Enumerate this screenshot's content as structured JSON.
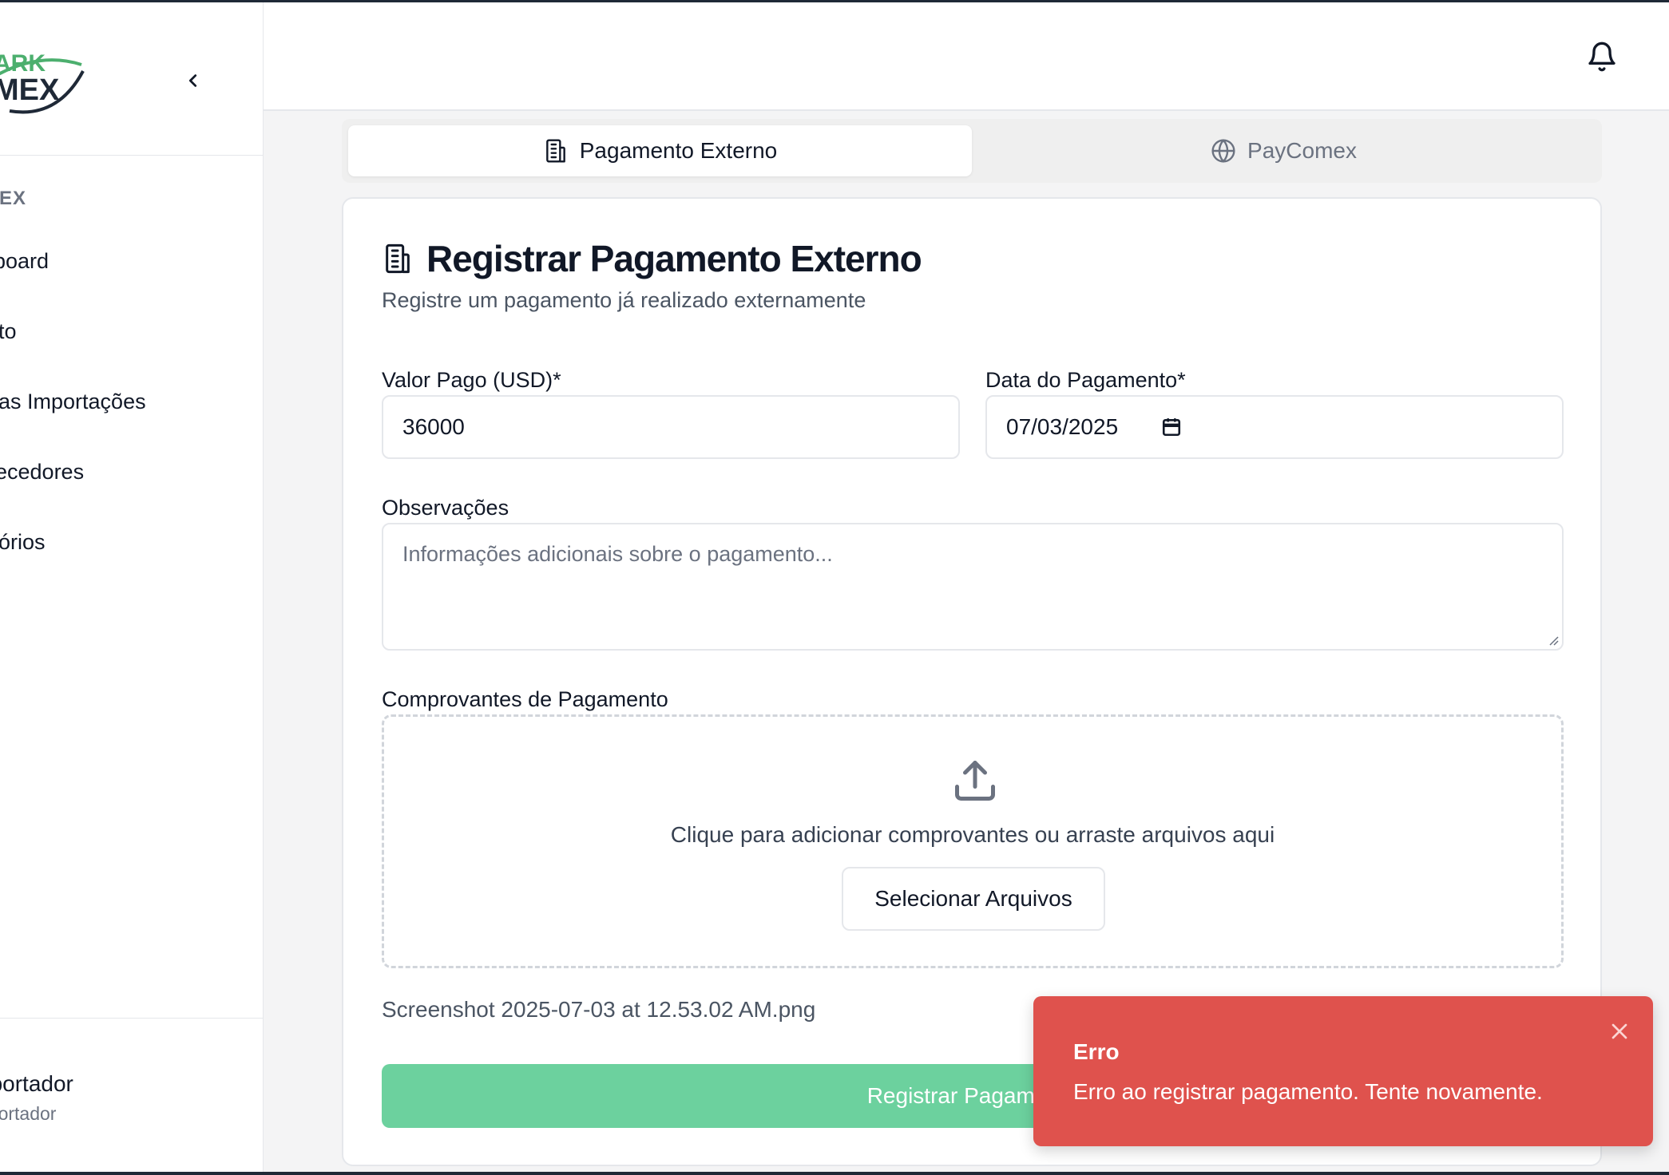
{
  "sidebar": {
    "section_label": "MEX",
    "collapse_icon": "chevron-left-icon",
    "items": [
      {
        "label": "board"
      },
      {
        "label": "to"
      },
      {
        "label": "as Importações"
      },
      {
        "label": "ecedores"
      },
      {
        "label": "órios"
      }
    ],
    "user": {
      "name": "nportador",
      "role": "nportador"
    }
  },
  "topbar": {
    "notification_icon": "bell-icon"
  },
  "tabs": [
    {
      "label": "Pagamento Externo",
      "icon": "building-icon",
      "active": true
    },
    {
      "label": "PayComex",
      "icon": "globe-icon",
      "active": false
    }
  ],
  "form": {
    "title": "Registrar Pagamento Externo",
    "subtitle": "Registre um pagamento já realizado externamente",
    "amount_label": "Valor Pago (USD)*",
    "amount_value": "36000",
    "date_label": "Data do Pagamento*",
    "date_value": "07/03/2025",
    "notes_label": "Observações",
    "notes_placeholder": "Informações adicionais sobre o pagamento...",
    "receipts_label": "Comprovantes de Pagamento",
    "drop_text": "Clique para adicionar comprovantes ou arraste arquivos aqui",
    "select_button": "Selecionar Arquivos",
    "attached_file": "Screenshot 2025-07-03 at 12.53.02 AM.png",
    "submit_button": "Registrar Pagamento"
  },
  "toast": {
    "title": "Erro",
    "message": "Erro ao registrar pagamento. Tente novamente.",
    "color": "#df524d"
  },
  "colors": {
    "brand_green": "#4caf6e",
    "submit_green": "#6cd19e",
    "error_red": "#df524d"
  }
}
